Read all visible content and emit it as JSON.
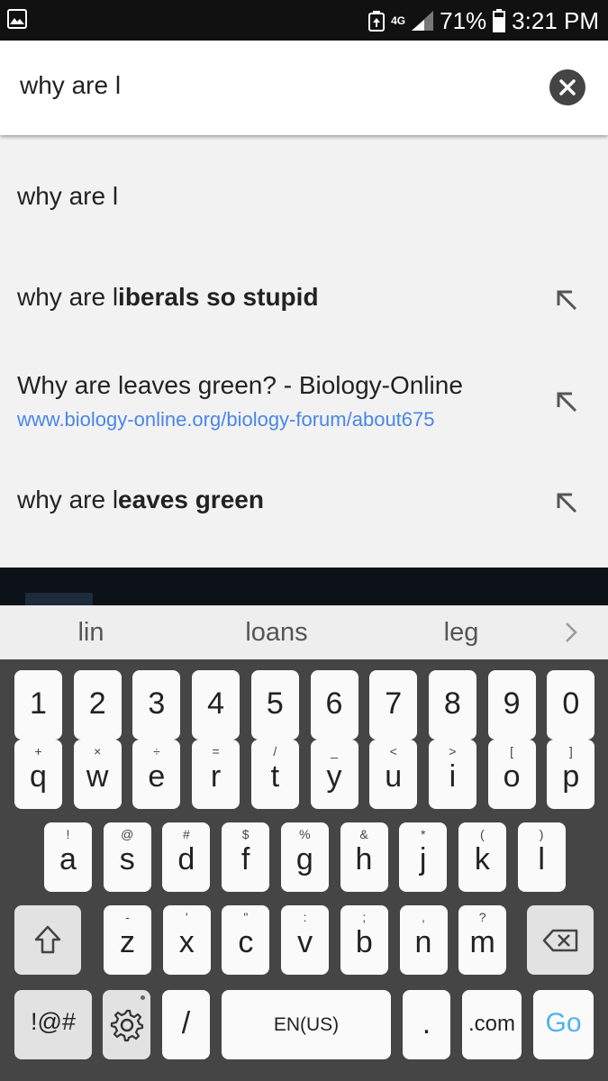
{
  "status_bar": {
    "network": "4G",
    "battery": "71%",
    "time": "3:21 PM"
  },
  "search": {
    "query": "why are l"
  },
  "suggestions": [
    {
      "plain": "why are l",
      "bold": "",
      "icon": ""
    },
    {
      "plain": "why are l",
      "bold": "iberals so stupid",
      "icon": "arrow-up-left-icon"
    },
    {
      "plain": "Why are leaves green? - Biology-Online",
      "bold": "",
      "url": "www.biology-online.org/biology-forum/about675",
      "icon": "arrow-up-left-icon"
    },
    {
      "plain": "why are l",
      "bold": "eaves green",
      "icon": "arrow-up-left-icon"
    }
  ],
  "predictions": [
    "lin",
    "loans",
    "leg"
  ],
  "keyboard": {
    "numbers": [
      "1",
      "2",
      "3",
      "4",
      "5",
      "6",
      "7",
      "8",
      "9",
      "0"
    ],
    "row1": [
      [
        "q",
        "+"
      ],
      [
        "w",
        "×"
      ],
      [
        "e",
        "÷"
      ],
      [
        "r",
        "="
      ],
      [
        "t",
        "/"
      ],
      [
        "y",
        "_"
      ],
      [
        "u",
        "<"
      ],
      [
        "i",
        ">"
      ],
      [
        "o",
        "["
      ],
      [
        "p",
        "]"
      ]
    ],
    "row2": [
      [
        "a",
        "!"
      ],
      [
        "s",
        "@"
      ],
      [
        "d",
        "#"
      ],
      [
        "f",
        "$"
      ],
      [
        "g",
        "%"
      ],
      [
        "h",
        "&"
      ],
      [
        "j",
        "*"
      ],
      [
        "k",
        "("
      ],
      [
        "l",
        ")"
      ]
    ],
    "row3": [
      [
        "z",
        "-"
      ],
      [
        "x",
        "'"
      ],
      [
        "c",
        "\""
      ],
      [
        "v",
        ":"
      ],
      [
        "b",
        ";"
      ],
      [
        "n",
        ","
      ],
      [
        "m",
        "?"
      ]
    ],
    "symbols": "!@#",
    "slash": "/",
    "space": "EN(US)",
    "period": ".",
    "dotcom": ".com",
    "go": "Go",
    "go_color": "#4fb3e8",
    "shift_icon": "shift-icon",
    "backspace_icon": "backspace-icon",
    "settings_icon": "gear-icon"
  }
}
